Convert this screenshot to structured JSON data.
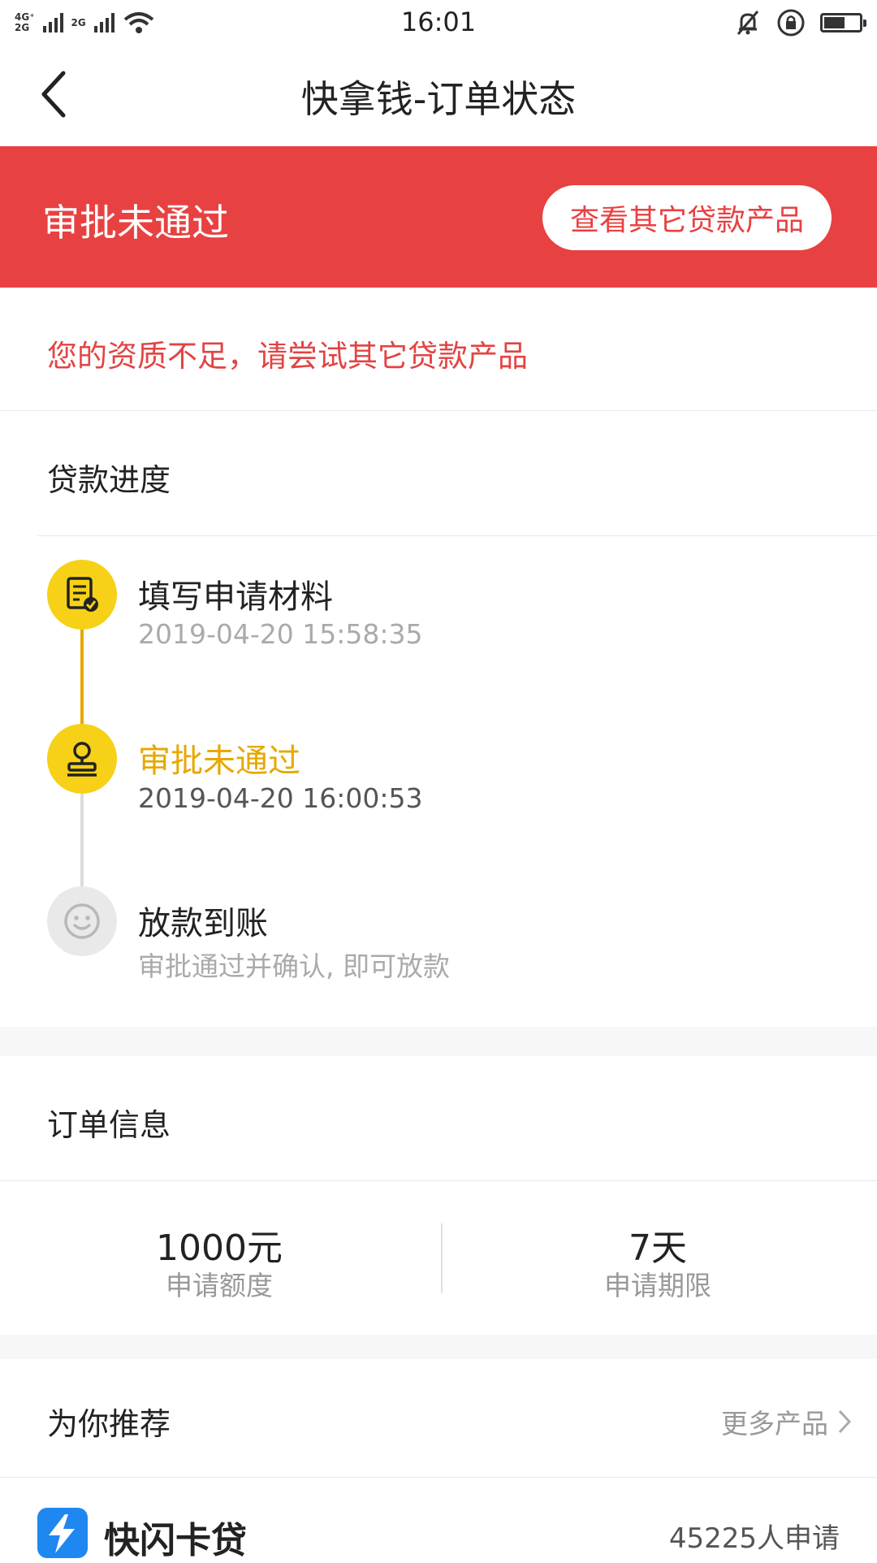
{
  "status_bar": {
    "net_top": "4G⁺",
    "net_bottom": "2G",
    "net_2g": "2G",
    "time": "16:01",
    "battery_level": 0.6
  },
  "nav": {
    "title": "快拿钱-订单状态"
  },
  "banner": {
    "status": "审批未通过",
    "button_label": "查看其它贷款产品",
    "color": "#e84142"
  },
  "reason": "您的资质不足，请尝试其它贷款产品",
  "progress": {
    "title": "贷款进度",
    "steps": [
      {
        "title": "填写申请材料",
        "subtitle": "2019-04-20 15:58:35",
        "icon": "form-check-icon",
        "state": "done"
      },
      {
        "title": "审批未通过",
        "subtitle": "2019-04-20 16:00:53",
        "icon": "stamp-icon",
        "state": "current"
      },
      {
        "title": "放款到账",
        "subtitle": "审批通过并确认, 即可放款",
        "icon": "smiley-icon",
        "state": "pending"
      }
    ]
  },
  "order": {
    "title": "订单信息",
    "amount_value": "1000元",
    "amount_label": "申请额度",
    "term_value": "7天",
    "term_label": "申请期限"
  },
  "recommend": {
    "title": "为你推荐",
    "more_label": "更多产品",
    "product_name": "快闪卡贷",
    "product_count": "45225人申请"
  }
}
